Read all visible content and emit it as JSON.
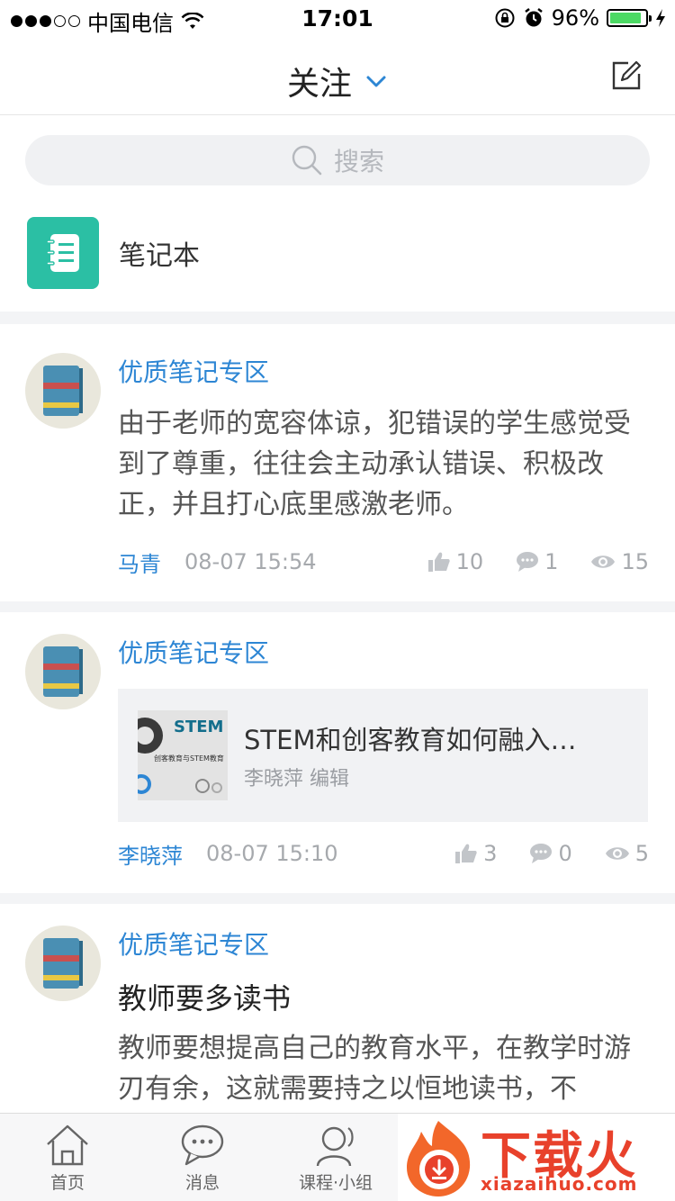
{
  "status_bar": {
    "carrier": "中国电信",
    "time": "17:01",
    "battery": "96%"
  },
  "nav": {
    "title": "关注"
  },
  "search": {
    "placeholder": "搜索"
  },
  "notebook": {
    "label": "笔记本"
  },
  "feed": [
    {
      "category": "优质笔记专区",
      "body": "由于老师的宽容体谅，犯错误的学生感觉受到了尊重，往往会主动承认错误、积极改正，并且打心底里感激老师。",
      "author": "马青",
      "time": "08-07 15:54",
      "likes": "10",
      "comments": "1",
      "views": "15"
    },
    {
      "category": "优质笔记专区",
      "attachment": {
        "title": "STEM和创客教育如何融入…",
        "subtitle": "李晓萍 编辑",
        "thumb_title": "STEM",
        "thumb_subtitle": "创客教育与STEM教育"
      },
      "author": "李晓萍",
      "time": "08-07 15:10",
      "likes": "3",
      "comments": "0",
      "views": "5"
    },
    {
      "category": "优质笔记专区",
      "heading": "教师要多读书",
      "body": "教师要想提高自己的教育水平，在教学时游刃有余，这就需要持之以恒地读书，不"
    }
  ],
  "tabbar": {
    "tabs": [
      {
        "label": "首页"
      },
      {
        "label": "消息"
      },
      {
        "label": "课程·小组"
      }
    ]
  },
  "watermark": {
    "text": "下载火",
    "url": "xiazaihuo.com"
  },
  "colors": {
    "accent": "#2d86d4",
    "notebook": "#2bbfa4",
    "meta": "#a6a9ad",
    "watermark": "#e8412b"
  }
}
